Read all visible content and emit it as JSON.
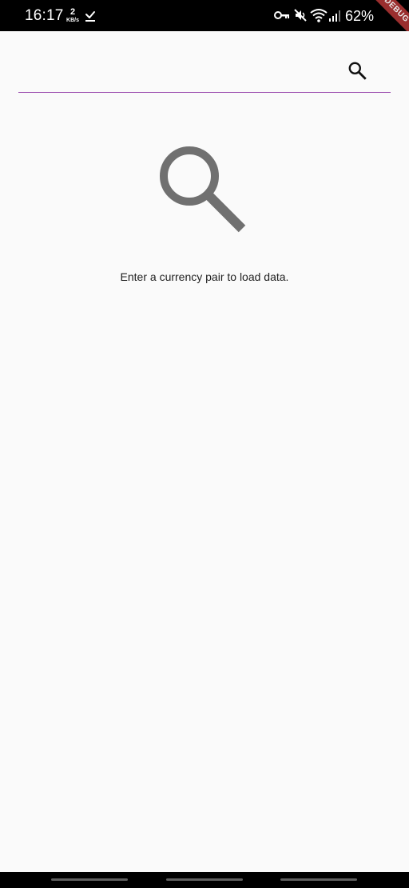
{
  "status_bar": {
    "time": "16:17",
    "network_speed_value": "2",
    "network_speed_unit": "KB/s",
    "battery_percent": "62%",
    "icons": [
      "download-done-icon",
      "vpn-key-icon",
      "mute-icon",
      "wifi-icon",
      "signal-icon",
      "battery-icon"
    ]
  },
  "debug_banner": {
    "label": "DEBUG"
  },
  "search": {
    "value": "",
    "placeholder": "",
    "button_icon": "search-icon",
    "underline_color": "#9c4fb0"
  },
  "empty_state": {
    "icon": "search-icon",
    "icon_color": "#707070",
    "message": "Enter a currency pair to load data."
  },
  "navigation_bar": {
    "handles": 3
  }
}
